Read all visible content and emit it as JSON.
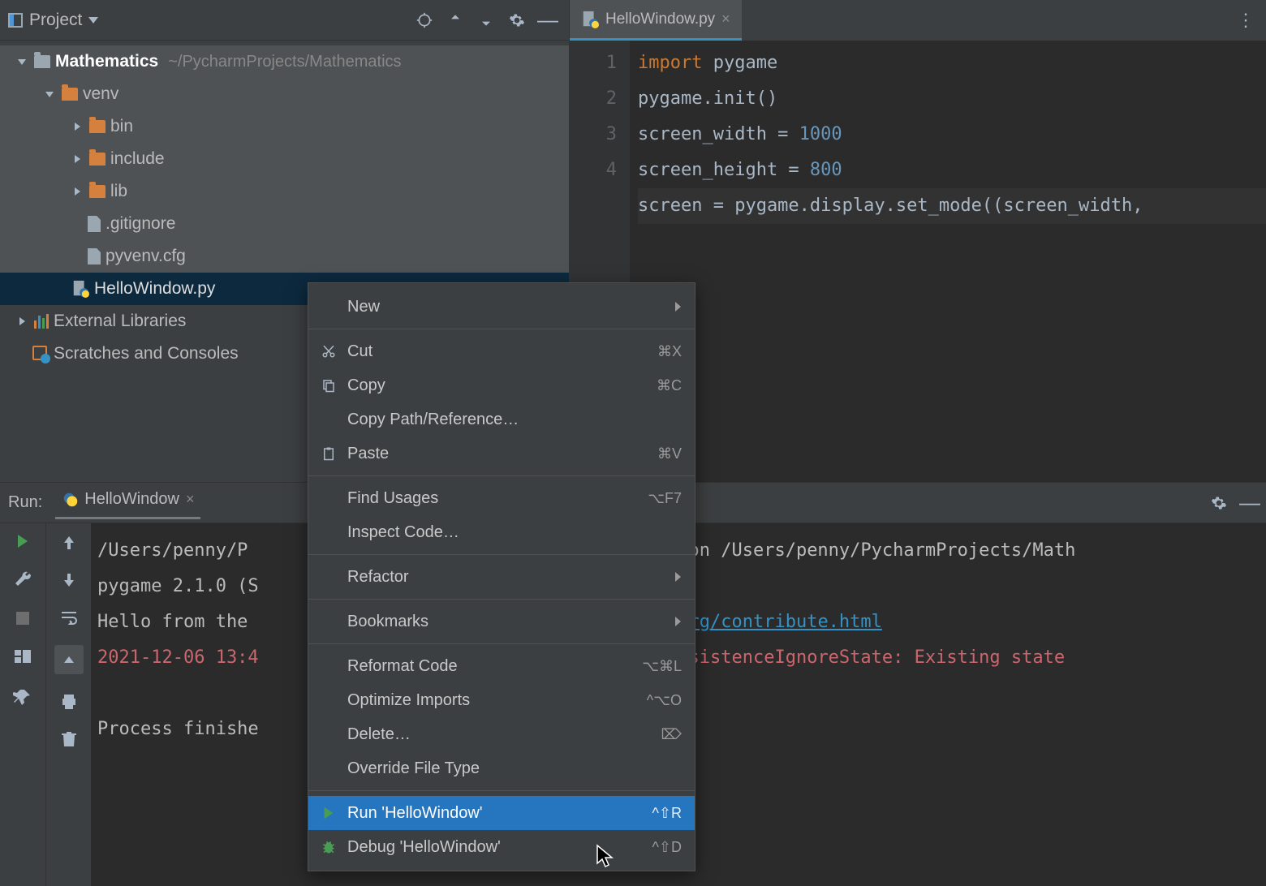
{
  "sidebar": {
    "title": "Project",
    "root": {
      "name": "Mathematics",
      "path": "~/PycharmProjects/Mathematics"
    },
    "venv": {
      "name": "venv"
    },
    "folders": [
      "bin",
      "include",
      "lib"
    ],
    "files": [
      ".gitignore",
      "pyvenv.cfg"
    ],
    "selected_file": "HelloWindow.py",
    "external": "External Libraries",
    "scratches": "Scratches and Consoles"
  },
  "editor": {
    "tab_label": "HelloWindow.py",
    "line_numbers": [
      "1",
      "2",
      "3",
      "4"
    ],
    "code": {
      "l1_kw": "import",
      "l1_rest": " pygame",
      "l2": "pygame.init()",
      "l3a": "screen_width = ",
      "l3b": "1000",
      "l4a": "screen_height = ",
      "l4b": "800",
      "l5": "screen = pygame.display.set_mode((screen_width,"
    }
  },
  "run": {
    "label": "Run:",
    "tab": "HelloWindow",
    "console": {
      "l1a": "/Users/penny/P",
      "l1b": "bin/python /Users/penny/PycharmProjects/Math",
      "l2": "pygame 2.1.0 (S",
      "l3a": "Hello from the ",
      "l3link": "ygame.org/contribute.html",
      "l4a": "2021-12-06 13:4",
      "l4b": "pplePersistenceIgnoreState: Existing state",
      "l5": "Process finishe"
    }
  },
  "context_menu": {
    "items": [
      {
        "label": "New",
        "sub": true
      },
      {
        "sep": true
      },
      {
        "label": "Cut",
        "short": "⌘X",
        "icon": "cut"
      },
      {
        "label": "Copy",
        "short": "⌘C",
        "icon": "copy"
      },
      {
        "label": "Copy Path/Reference…"
      },
      {
        "label": "Paste",
        "short": "⌘V",
        "icon": "paste"
      },
      {
        "sep": true
      },
      {
        "label": "Find Usages",
        "short": "⌥F7"
      },
      {
        "label": "Inspect Code…"
      },
      {
        "sep": true
      },
      {
        "label": "Refactor",
        "sub": true
      },
      {
        "sep": true
      },
      {
        "label": "Bookmarks",
        "sub": true
      },
      {
        "sep": true
      },
      {
        "label": "Reformat Code",
        "short": "⌥⌘L"
      },
      {
        "label": "Optimize Imports",
        "short": "^⌥O"
      },
      {
        "label": "Delete…",
        "short": "⌦"
      },
      {
        "label": "Override File Type"
      },
      {
        "sep": true
      },
      {
        "label": "Run 'HelloWindow'",
        "short": "^⇧R",
        "icon": "run",
        "hover": true
      },
      {
        "label": "Debug 'HelloWindow'",
        "short": "^⇧D",
        "icon": "debug"
      }
    ]
  }
}
